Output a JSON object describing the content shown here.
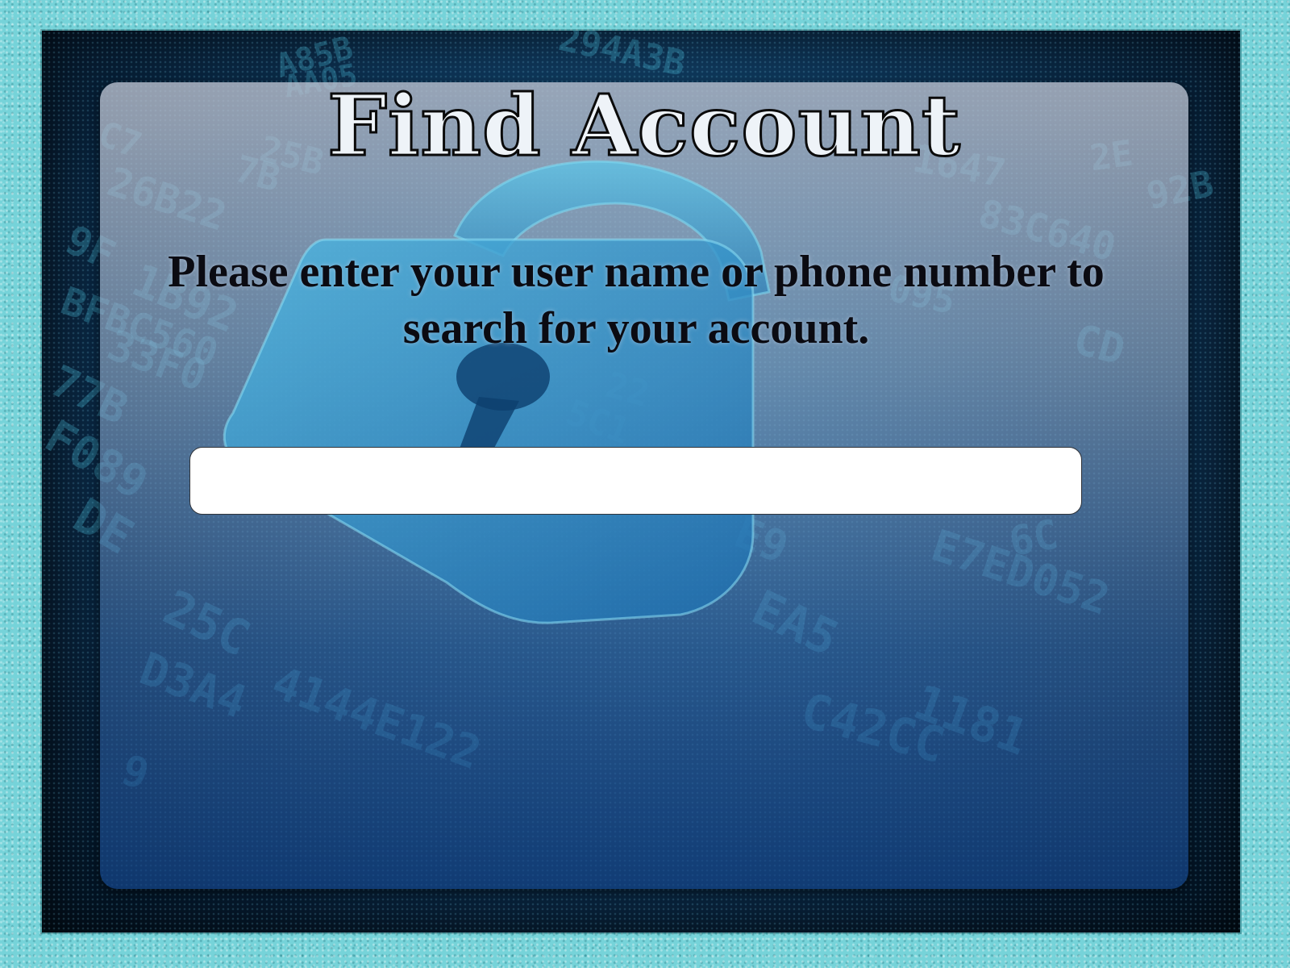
{
  "page": {
    "title": "Find Account",
    "instructions": "Please enter your user name or phone number to search for your account.",
    "search": {
      "value": "",
      "placeholder": ""
    }
  },
  "background": {
    "decor_text": [
      "A85B",
      "294A3B",
      "AA05",
      "C7",
      "7B",
      "1647",
      "2E",
      "92B",
      "26B22",
      "25B",
      "83C640",
      "9F",
      "1B92",
      "095",
      "BFBC560",
      "33F0",
      "22",
      "77B",
      "5C1",
      "F089",
      "DE",
      "E9",
      "E7ED052",
      "EA5",
      "25C",
      "4144E122",
      "1181",
      "C42CC",
      "D3A4",
      "9",
      "6C",
      "CD"
    ],
    "colors": {
      "frame": "#76d3d9",
      "panel_top": "#bec4d2",
      "panel_bottom": "#14468c",
      "title_fill": "#eef3f8"
    }
  },
  "icons": {
    "lock": "lock-open-icon"
  }
}
